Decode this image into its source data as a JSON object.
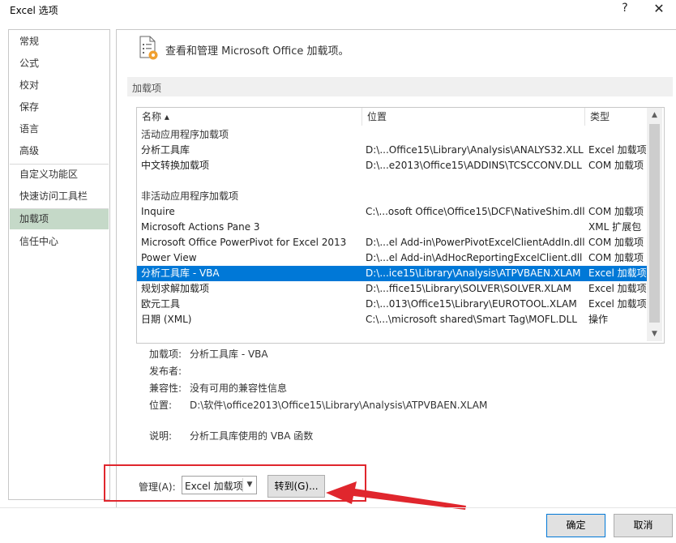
{
  "window": {
    "title": "Excel 选项",
    "help_glyph": "?",
    "close_glyph": "✕"
  },
  "sidebar": {
    "items": [
      {
        "label": "常规"
      },
      {
        "label": "公式"
      },
      {
        "label": "校对"
      },
      {
        "label": "保存"
      },
      {
        "label": "语言"
      },
      {
        "label": "高级"
      },
      {
        "label": "自定义功能区"
      },
      {
        "label": "快速访问工具栏"
      },
      {
        "label": "加载项",
        "selected": true
      },
      {
        "label": "信任中心"
      }
    ]
  },
  "header": {
    "text": "查看和管理 Microsoft Office 加载项。",
    "icon": "addins-gear-icon"
  },
  "section": {
    "label": "加载项"
  },
  "table": {
    "columns": {
      "name": "名称 ▴",
      "location": "位置",
      "type": "类型"
    },
    "active_group": "活动应用程序加载项",
    "active_rows": [
      {
        "name": "分析工具库",
        "location": "D:\\...Office15\\Library\\Analysis\\ANALYS32.XLL",
        "type": "Excel 加载项"
      },
      {
        "name": "中文转换加载项",
        "location": "D:\\...e2013\\Office15\\ADDINS\\TCSCCONV.DLL",
        "type": "COM 加载项"
      }
    ],
    "inactive_group": "非活动应用程序加载项",
    "inactive_rows": [
      {
        "name": "Inquire",
        "location": "C:\\...osoft Office\\Office15\\DCF\\NativeShim.dll",
        "type": "COM 加载项"
      },
      {
        "name": "Microsoft Actions Pane 3",
        "location": "",
        "type": "XML 扩展包"
      },
      {
        "name": "Microsoft Office PowerPivot for Excel 2013",
        "location": "D:\\...el Add-in\\PowerPivotExcelClientAddIn.dll",
        "type": "COM 加载项"
      },
      {
        "name": "Power View",
        "location": "D:\\...el Add-in\\AdHocReportingExcelClient.dll",
        "type": "COM 加载项"
      },
      {
        "name": "分析工具库 - VBA",
        "location": "D:\\...ice15\\Library\\Analysis\\ATPVBAEN.XLAM",
        "type": "Excel 加载项",
        "selected": true
      },
      {
        "name": "规划求解加载项",
        "location": "D:\\...ffice15\\Library\\SOLVER\\SOLVER.XLAM",
        "type": "Excel 加载项"
      },
      {
        "name": "欧元工具",
        "location": "D:\\...013\\Office15\\Library\\EUROTOOL.XLAM",
        "type": "Excel 加载项"
      },
      {
        "name": "日期 (XML)",
        "location": "C:\\...\\microsoft shared\\Smart Tag\\MOFL.DLL",
        "type": "操作"
      }
    ]
  },
  "details": {
    "addin_label": "加载项:",
    "addin_value": "分析工具库 - VBA",
    "publisher_label": "发布者:",
    "publisher_value": "",
    "compat_label": "兼容性:",
    "compat_value": "没有可用的兼容性信息",
    "location_label": "位置:",
    "location_value": "D:\\软件\\office2013\\Office15\\Library\\Analysis\\ATPVBAEN.XLAM",
    "desc_label": "说明:",
    "desc_value": "分析工具库使用的 VBA 函数"
  },
  "manage": {
    "label": "管理(A):",
    "select_value": "Excel 加载项",
    "go_label": "转到(G)..."
  },
  "footer": {
    "ok_label": "确定",
    "cancel_label": "取消"
  },
  "colors": {
    "selection": "#0078d7",
    "sidebar_selected": "#c5d9c8",
    "annotation": "#e0262d"
  }
}
